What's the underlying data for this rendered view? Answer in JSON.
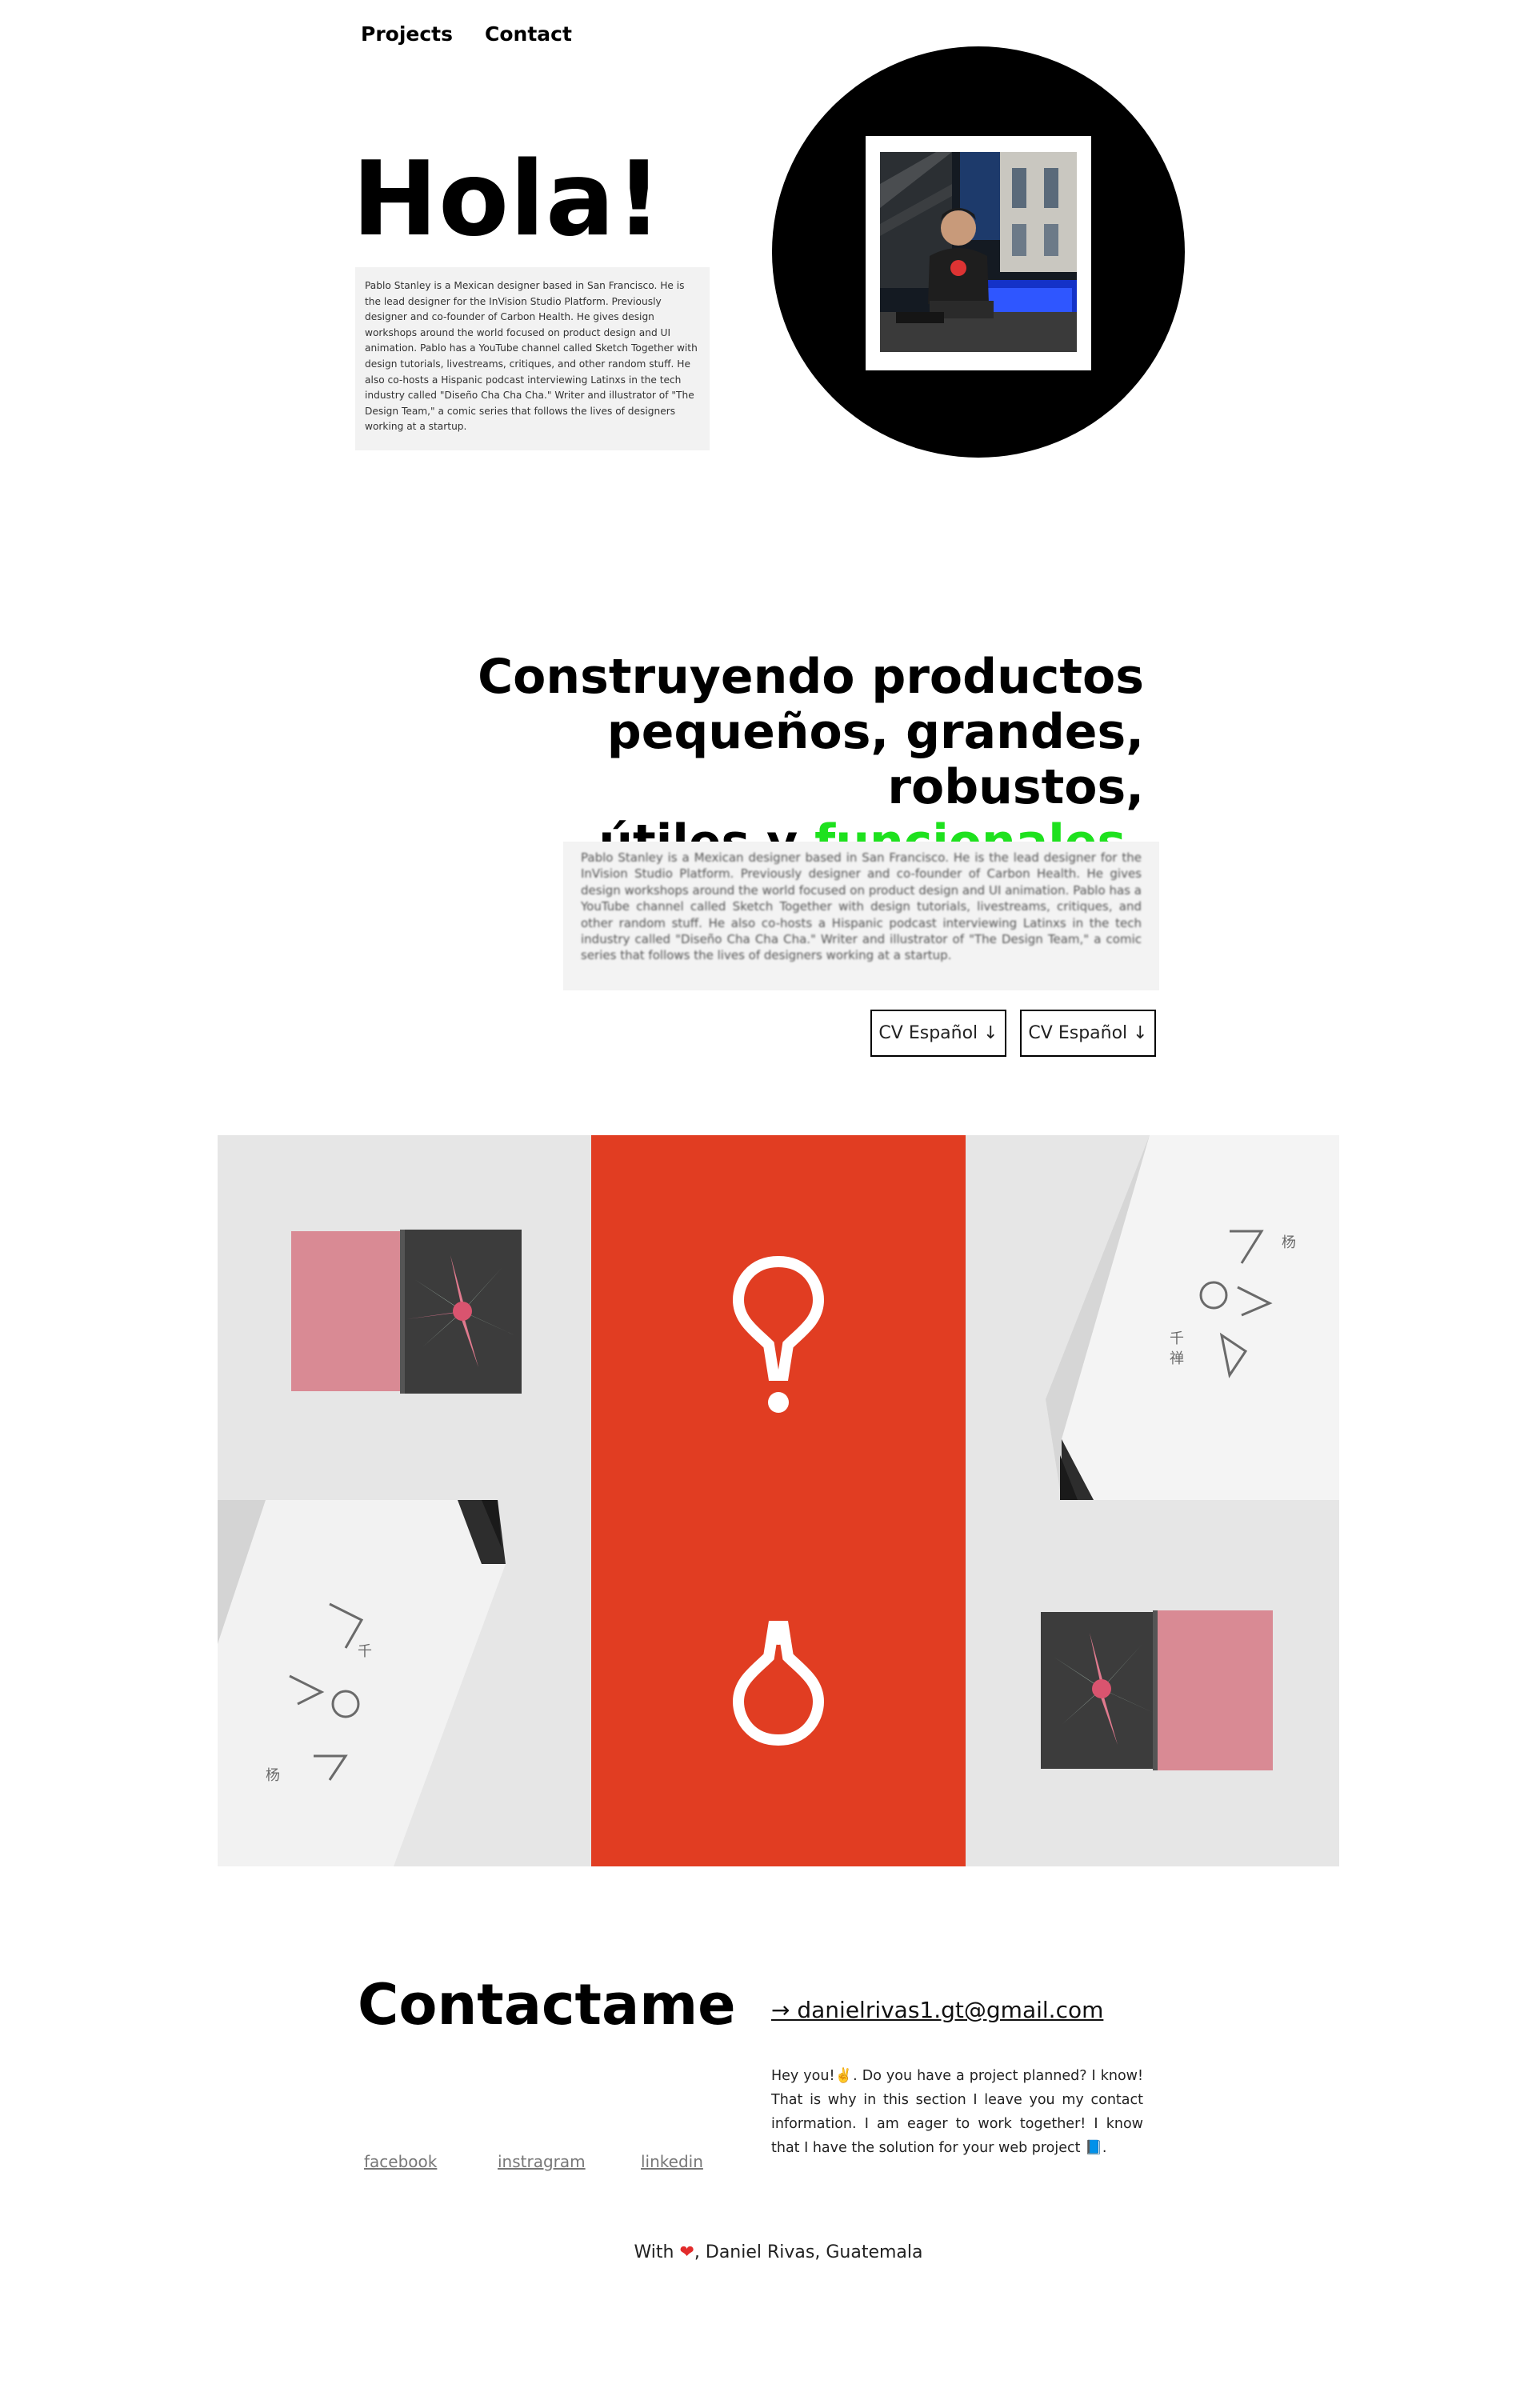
{
  "nav": {
    "items": [
      "Projects",
      "Contact"
    ]
  },
  "hero": {
    "title": "Hola!",
    "bio": "Pablo Stanley is a Mexican designer based in San Francisco. He is the lead designer for the InVision Studio Platform. Previously designer and co-founder of Carbon Health. He gives design workshops around the world focused on product design and UI animation. Pablo has a YouTube channel called Sketch Together with design tutorials, livestreams, critiques, and other random stuff. He also co-hosts a Hispanic podcast interviewing Latinxs in the tech industry called \"Diseño Cha Cha Cha.\" Writer and illustrator of \"The Design Team,\" a comic series that follows the lives of designers working at a startup."
  },
  "tagline": {
    "line1": "Construyendo productos",
    "line2": "pequeños, grandes, robustos,",
    "line3_prefix": "útiles y ",
    "line3_accent": "funcionales",
    "line3_suffix": ".",
    "accent_color": "#1ee11e"
  },
  "cv_buttons": [
    "CV Español ↓",
    "CV Español ↓"
  ],
  "gallery": {
    "brand_red": "#e13d22",
    "tiles": [
      {
        "kind": "book-open-icon"
      },
      {
        "kind": "exclamation-mark-icon"
      },
      {
        "kind": "box-corner-icon"
      },
      {
        "kind": "box-corner-icon"
      },
      {
        "kind": "inverted-exclamation-icon"
      },
      {
        "kind": "book-open-icon"
      }
    ]
  },
  "contact": {
    "title": "Contactame",
    "email": "→ danielrivas1.gt@gmail.com",
    "text": "Hey you!✌️. Do you have a project planned? I know! That is why in this section I leave you my contact information. I am eager to work together! I know that I have the solution for your web project 📘.",
    "social": [
      "facebook",
      "instragram",
      "linkedin"
    ]
  },
  "footer": {
    "prefix": "With ",
    "heart": "❤",
    "suffix": ", Daniel Rivas, Guatemala"
  }
}
